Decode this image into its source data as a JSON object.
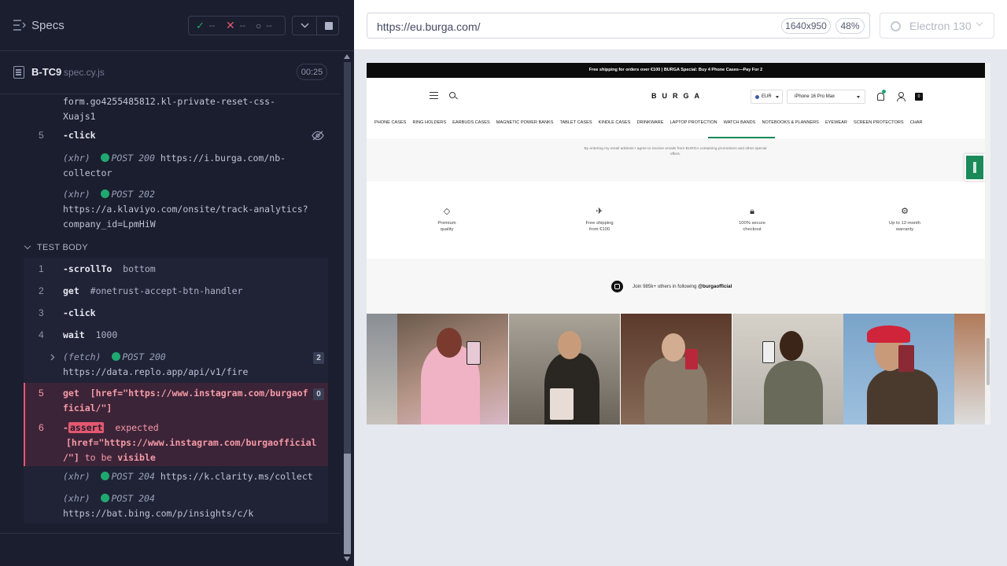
{
  "header": {
    "title": "Specs",
    "passed": "--",
    "failed": "--",
    "pending": "--"
  },
  "spec": {
    "name": "B-TC9",
    "ext": "spec.cy.js",
    "duration": "00:25"
  },
  "log_top": {
    "line_a": "form.go4255485812.kl-private-reset-css-",
    "line_b": "Xuajs1",
    "step5_num": "5",
    "step5_cmd": "-click",
    "xhr1_prefix": "(xhr)",
    "xhr1_method": "POST 200",
    "xhr1_url_a": "https://i.burga.com/nb-",
    "xhr1_url_b": "collector",
    "xhr2_prefix": "(xhr)",
    "xhr2_method": "POST 202",
    "xhr2_url_a": "https://a.klaviyo.com/onsite/track-analytics?",
    "xhr2_url_b": "company_id=LpmHiW"
  },
  "test_body": {
    "label": "TEST BODY",
    "steps": [
      {
        "num": "1",
        "cmd": "-scrollTo",
        "arg": "bottom"
      },
      {
        "num": "2",
        "cmd": "get",
        "arg": "#onetrust-accept-btn-handler"
      },
      {
        "num": "3",
        "cmd": "-click",
        "arg": ""
      },
      {
        "num": "4",
        "cmd": "wait",
        "arg": "1000"
      }
    ],
    "fetch": {
      "prefix": "(fetch)",
      "method": "POST 200",
      "url": "https://data.replo.app/api/v1/fire",
      "count": "2"
    },
    "fail_get": {
      "num": "5",
      "cmd": "get",
      "arg_a": "[href=\"https://www.instagram.com/burgaof",
      "arg_b": "ficial/\"]",
      "count": "0"
    },
    "fail_assert": {
      "num": "6",
      "dash": "-",
      "tag": "assert",
      "expected": "expected",
      "line2": "[href=\"https://www.instagram.com/burgaofficial",
      "line3_a": "/\"]",
      "line3_b": "to be",
      "line3_c": "visible"
    },
    "xhr3": {
      "prefix": "(xhr)",
      "method": "POST 204",
      "url": "https://k.clarity.ms/collect"
    },
    "xhr4": {
      "prefix": "(xhr)",
      "method": "POST 204",
      "url": "https://bat.bing.com/p/insights/c/k"
    }
  },
  "browser": {
    "url": "https://eu.burga.com/",
    "viewport": "1640x950",
    "zoom": "48%",
    "name": "Electron 130"
  },
  "site": {
    "promo": "Free shipping for orders over €100   |   BURGA Special: Buy 4 Phone Cases—Pay For 2",
    "logo": "BURGA",
    "currency": "EUR",
    "model": "iPhone 16 Pro Max",
    "categories": [
      "PHONE CASES",
      "RING HOLDERS",
      "EARBUDS CASES",
      "MAGNETIC POWER BANKS",
      "TABLET CASES",
      "KINDLE CASES",
      "DRINKWARE",
      "LAPTOP PROTECTION",
      "WATCH BANDS",
      "NOTEBOOKS & PLANNERS",
      "EYEWEAR",
      "SCREEN PROTECTORS",
      "CHAR"
    ],
    "consent": "By entering my email address I agree to receive emails from BURGA containing promotions and other special offers.",
    "features": [
      {
        "icon": "diamond-icon",
        "line1": "Premium",
        "line2": "quality"
      },
      {
        "icon": "plane-icon",
        "line1": "Free shipping",
        "line2": "from €100"
      },
      {
        "icon": "lock-icon",
        "line1": "100% secure",
        "line2": "checkout"
      },
      {
        "icon": "badge-icon",
        "line1": "Up to 12-month",
        "line2": "warranty"
      }
    ],
    "insta_pre": "Join",
    "insta_count": "985k+",
    "insta_mid": "others in following",
    "insta_handle": "@burgaofficial"
  },
  "colors": {
    "panel_bg": "#1b1e2e",
    "pass": "#1fa971",
    "fail": "#e45770",
    "brand_green": "#1a8a5a"
  }
}
